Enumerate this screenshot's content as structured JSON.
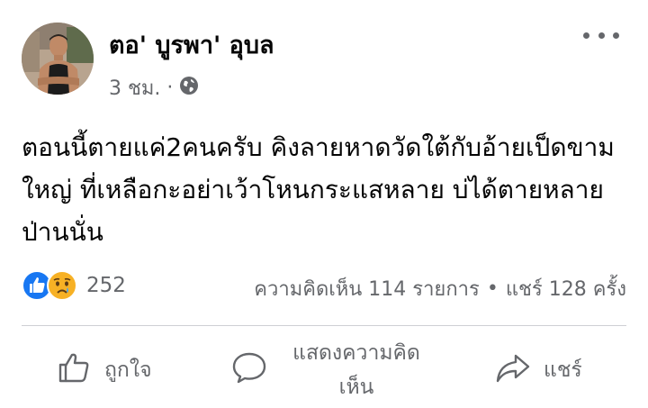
{
  "post": {
    "author": "ตอ' บูรพา' อุบล",
    "time": "3 ชม.",
    "separator": "·",
    "audience_icon": "globe-icon",
    "more_icon": "more-options-icon",
    "text": "ตอนนี้ตายแค่2คนครับ คิงลายหาดวัดใต้กับอ้ายเป็ดขามใหญ่ ที่เหลือกะอย่าเว้าโหนกระแสหลาย บ่ได้ตายหลายป่านนั่น"
  },
  "reactions": {
    "icons": [
      "like-reaction-icon",
      "sad-reaction-icon"
    ],
    "count": "252"
  },
  "stats": {
    "comments": "ความคิดเห็น 114 รายการ",
    "separator": "•",
    "shares": "แชร์ 128 ครั้ง"
  },
  "actions": {
    "like": "ถูกใจ",
    "comment": "แสดงความคิดเห็น",
    "share": "แชร์"
  },
  "colors": {
    "like_blue": "#1877f2",
    "sad_yellow": "#f7b125",
    "secondary_text": "#65676b",
    "divider": "#ced0d4"
  }
}
